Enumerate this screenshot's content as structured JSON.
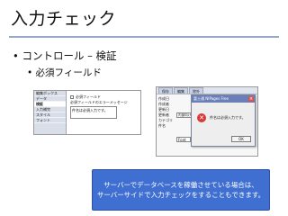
{
  "slide": {
    "title": "入力チェック",
    "bullets": [
      "• コントロール – 検証",
      "• 必須フィールド"
    ]
  },
  "property_panel": {
    "menu_items": [
      "編集ボックス",
      "データ",
      "検証",
      "入力補完",
      "スタイル",
      "フォント"
    ],
    "active_item": "検証",
    "required_field_label": "必須フィールド",
    "required_message_label": "必須フィールドのエラーメッセージ",
    "message_value": "件名は必須入力です。"
  },
  "form_window": {
    "tabs": [
      "保存",
      "編集",
      "除外"
    ],
    "field_labels": [
      "作成日",
      "作成者",
      "更新日",
      "更新者",
      "カテゴリ",
      "件名"
    ],
    "select_value": "内部向け",
    "font_row_value": "Font"
  },
  "error_dialog": {
    "title": "富士通 NIPages Free",
    "message": "件名は必須入力です。",
    "ok_label": "OK"
  },
  "callout": {
    "line1": "サーバーでデータベースを稼働させている場合は、",
    "line2": "サーバーサイドで入力チェックをすることもできます。"
  }
}
